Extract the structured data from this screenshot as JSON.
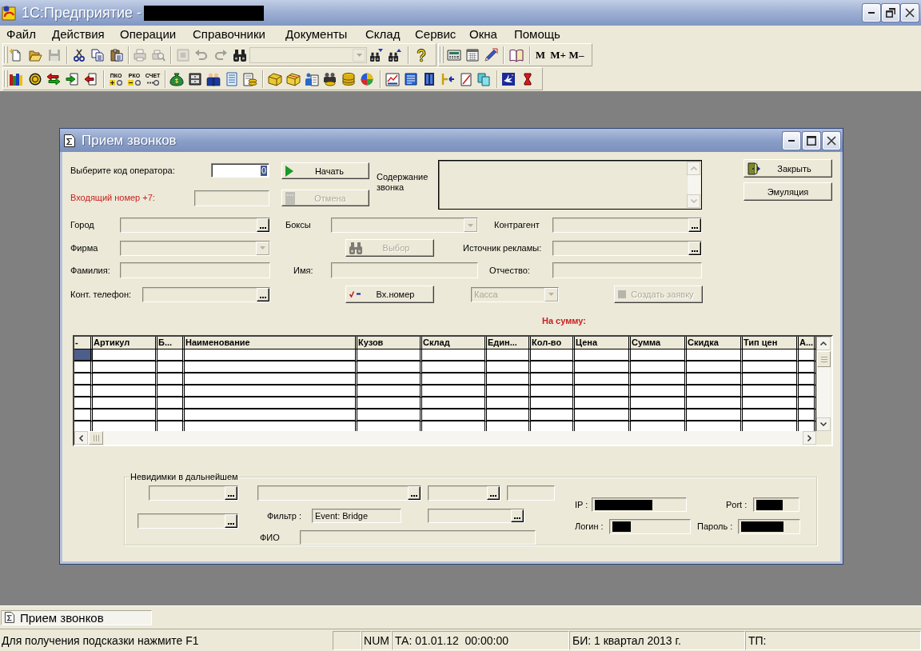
{
  "app": {
    "title": "1С:Предприятие -",
    "title_redacted": true
  },
  "menu": [
    "Файл",
    "Действия",
    "Операции",
    "Справочники",
    "Документы",
    "Склад",
    "Сервис",
    "Окна",
    "Помощь"
  ],
  "toolbars": [
    {
      "items": [
        {
          "kind": "icon",
          "disabled": false
        },
        {
          "kind": "icon",
          "disabled": false
        },
        {
          "kind": "icon",
          "disabled": true
        },
        {
          "kind": "separator"
        },
        {
          "kind": "icon",
          "disabled": false
        },
        {
          "kind": "icon",
          "disabled": false
        },
        {
          "kind": "icon",
          "disabled": false
        },
        {
          "kind": "separator"
        },
        {
          "kind": "icon",
          "disabled": true
        },
        {
          "kind": "icon",
          "disabled": true
        },
        {
          "kind": "separator"
        },
        {
          "kind": "icon",
          "disabled": true
        },
        {
          "kind": "icon",
          "disabled": true
        },
        {
          "kind": "icon",
          "disabled": true
        },
        {
          "kind": "icon",
          "disabled": false
        },
        {
          "kind": "combo",
          "disabled": true
        },
        {
          "kind": "icon",
          "disabled": false
        },
        {
          "kind": "icon",
          "disabled": false
        },
        {
          "kind": "separator"
        },
        {
          "kind": "icon",
          "disabled": false
        }
      ]
    },
    {
      "items": [
        {
          "kind": "icon",
          "disabled": false
        },
        {
          "kind": "icon",
          "disabled": false
        },
        {
          "kind": "icon",
          "disabled": false
        },
        {
          "kind": "separator"
        },
        {
          "kind": "icon",
          "disabled": false
        },
        {
          "kind": "separator"
        },
        {
          "kind": "text",
          "label": "M",
          "disabled": false
        },
        {
          "kind": "text",
          "label": "M+",
          "disabled": false
        },
        {
          "kind": "text",
          "label": "M–",
          "disabled": false
        }
      ]
    },
    {
      "items": [
        {
          "kind": "icon",
          "disabled": false
        },
        {
          "kind": "icon",
          "disabled": false
        },
        {
          "kind": "icon",
          "disabled": false
        },
        {
          "kind": "icon",
          "disabled": false
        },
        {
          "kind": "icon",
          "disabled": false
        },
        {
          "kind": "separator"
        },
        {
          "kind": "labeled",
          "label": "ПКО",
          "disabled": false
        },
        {
          "kind": "labeled",
          "label": "РКО",
          "disabled": false
        },
        {
          "kind": "labeled",
          "label": "СЧЕТ",
          "disabled": false
        },
        {
          "kind": "separator"
        },
        {
          "kind": "icon",
          "disabled": false
        },
        {
          "kind": "icon",
          "disabled": false
        },
        {
          "kind": "icon",
          "disabled": false
        },
        {
          "kind": "icon",
          "disabled": false
        },
        {
          "kind": "icon",
          "disabled": false
        },
        {
          "kind": "separator"
        },
        {
          "kind": "icon",
          "disabled": false
        },
        {
          "kind": "icon",
          "disabled": false
        },
        {
          "kind": "icon",
          "disabled": false
        },
        {
          "kind": "icon",
          "disabled": false
        },
        {
          "kind": "icon",
          "disabled": false
        },
        {
          "kind": "icon",
          "disabled": false
        },
        {
          "kind": "separator"
        },
        {
          "kind": "icon",
          "disabled": false
        },
        {
          "kind": "icon",
          "disabled": false
        },
        {
          "kind": "icon",
          "disabled": false
        },
        {
          "kind": "icon",
          "disabled": false
        },
        {
          "kind": "icon",
          "disabled": false
        },
        {
          "kind": "icon",
          "disabled": false
        },
        {
          "kind": "separator"
        },
        {
          "kind": "icon",
          "disabled": false
        },
        {
          "kind": "icon",
          "disabled": false
        }
      ]
    }
  ],
  "form": {
    "title": "Прием звонков",
    "operator": {
      "label": "Выберите код оператора:",
      "value": "0",
      "value_selected": true,
      "disabled": false
    },
    "incoming": {
      "label": "Входящий номер +7:",
      "disabled": true
    },
    "actions": [
      {
        "label": "Начать",
        "disabled": false
      },
      {
        "label": "Отмена",
        "disabled": true
      }
    ],
    "content": {
      "label": "Содержание звонка",
      "disabled": true
    },
    "side_buttons": [
      {
        "label": "Закрыть",
        "disabled": false
      },
      {
        "label": "Эмуляция",
        "disabled": false
      }
    ],
    "rows": [
      {
        "controls": [
          {
            "kind": "field",
            "label": "Город",
            "picker": true,
            "disabled": true
          },
          {
            "kind": "combo",
            "label": "Боксы",
            "disabled": true
          },
          {
            "kind": "field",
            "label": "Контрагент",
            "picker": true,
            "disabled": true
          }
        ]
      },
      {
        "controls": [
          {
            "kind": "combo",
            "label": "Фирма",
            "disabled": true
          },
          {
            "kind": "button",
            "label": "Выбор",
            "disabled": true
          },
          {
            "kind": "field",
            "label": "Источник рекламы:",
            "picker": true,
            "disabled": true
          }
        ]
      },
      {
        "controls": [
          {
            "kind": "field",
            "label": "Фамилия:",
            "picker": false,
            "disabled": true
          },
          {
            "kind": "field",
            "label": "Имя:",
            "picker": false,
            "disabled": true
          },
          {
            "kind": "field",
            "label": "Отчество:",
            "picker": false,
            "disabled": true
          }
        ]
      },
      {
        "controls": [
          {
            "kind": "field",
            "label": "Конт. телефон:",
            "picker": true,
            "disabled": true
          },
          {
            "kind": "button",
            "label": "Вх.номер",
            "disabled": false
          },
          {
            "kind": "combo",
            "value": "Касса",
            "disabled": true
          },
          {
            "kind": "button",
            "label": "Создать заявку",
            "disabled": true
          }
        ]
      }
    ],
    "total": {
      "label": "На сумму:"
    },
    "table": {
      "columns": [
        "-",
        "Артикул",
        "Б...",
        "Наименование",
        "Кузов",
        "Склад",
        "Един...",
        "Кол-во",
        "Цена",
        "Сумма",
        "Скидка",
        "Тип цен",
        "А..."
      ],
      "rows": [
        {
          "selected": true
        },
        {
          "selected": false
        },
        {
          "selected": false
        },
        {
          "selected": false
        },
        {
          "selected": false
        },
        {
          "selected": false
        },
        {
          "selected": false
        }
      ]
    },
    "hidden_group": {
      "title": "Невидимки в дальнейшем",
      "controls": [
        {
          "kind": "field",
          "picker": true,
          "disabled": true,
          "redacted": false
        },
        {
          "kind": "field",
          "picker": true,
          "disabled": true,
          "redacted": false
        },
        {
          "kind": "field",
          "picker": true,
          "disabled": true,
          "redacted": false
        },
        {
          "kind": "field",
          "picker": false,
          "disabled": true,
          "redacted": false
        },
        {
          "kind": "field",
          "label": "IP :",
          "picker": false,
          "disabled": true,
          "redacted": true
        },
        {
          "kind": "field",
          "label": "Port :",
          "picker": false,
          "disabled": true,
          "redacted": true
        },
        {
          "kind": "field",
          "picker": true,
          "disabled": true,
          "redacted": false
        },
        {
          "kind": "field",
          "label": "Фильтр :",
          "value": "Event: Bridge",
          "picker": false,
          "disabled": true,
          "redacted": false
        },
        {
          "kind": "field",
          "picker": true,
          "disabled": true,
          "redacted": false
        },
        {
          "kind": "field",
          "label": "Логин :",
          "picker": false,
          "disabled": true,
          "redacted": true
        },
        {
          "kind": "field",
          "label": "Пароль :",
          "picker": false,
          "disabled": true,
          "redacted": true
        },
        {
          "kind": "field",
          "label": "ФИО",
          "picker": false,
          "disabled": true,
          "redacted": false
        }
      ]
    }
  },
  "window_bar": [
    {
      "label": "Прием звонков",
      "selected": true
    }
  ],
  "status_bar": {
    "hint": "Для получения подсказки нажмите F1",
    "panels": [
      "NUM",
      "ТА: 01.01.12  00:00:00",
      "БИ: 1 квартал 2013 г.",
      "ТП:"
    ]
  }
}
